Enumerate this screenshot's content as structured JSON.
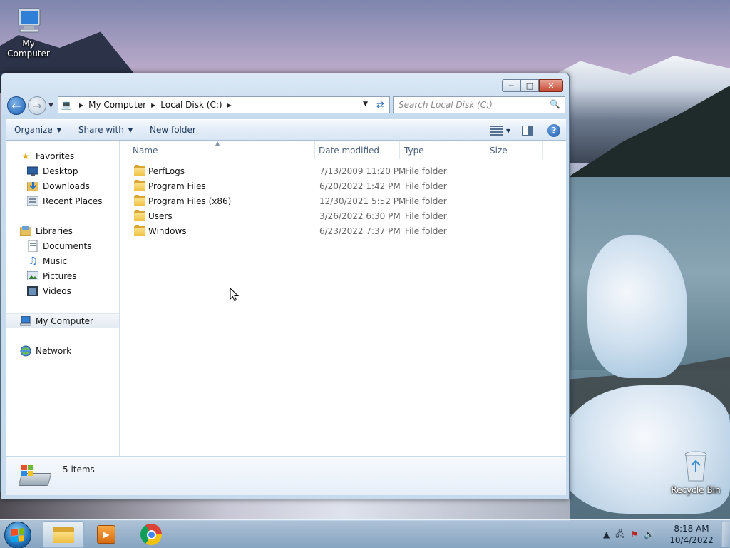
{
  "desktop": {
    "icons": [
      {
        "label": "My Computer",
        "icon": "computer-icon"
      },
      {
        "label": "Recycle Bin",
        "icon": "recycle-bin-icon"
      }
    ]
  },
  "window": {
    "caption_buttons": [
      "minimize",
      "maximize",
      "close"
    ],
    "address": {
      "crumbs": [
        "My Computer",
        "Local Disk (C:)"
      ]
    },
    "search": {
      "placeholder": "Search Local Disk (C:)"
    },
    "toolbar": {
      "organize": "Organize",
      "share_with": "Share with",
      "new_folder": "New folder"
    },
    "nav_pane": {
      "favorites": "Favorites",
      "favorites_items": [
        "Desktop",
        "Downloads",
        "Recent Places"
      ],
      "libraries": "Libraries",
      "libraries_items": [
        "Documents",
        "Music",
        "Pictures",
        "Videos"
      ],
      "my_computer": "My Computer",
      "network": "Network"
    },
    "columns": {
      "name": "Name",
      "date": "Date modified",
      "type": "Type",
      "size": "Size"
    },
    "files": [
      {
        "name": "PerfLogs",
        "date": "7/13/2009 11:20 PM",
        "type": "File folder"
      },
      {
        "name": "Program Files",
        "date": "6/20/2022 1:42 PM",
        "type": "File folder"
      },
      {
        "name": "Program Files (x86)",
        "date": "12/30/2021 5:52 PM",
        "type": "File folder"
      },
      {
        "name": "Users",
        "date": "3/26/2022 6:30 PM",
        "type": "File folder"
      },
      {
        "name": "Windows",
        "date": "6/23/2022 7:37 PM",
        "type": "File folder"
      }
    ],
    "details": {
      "count": "5 items"
    }
  },
  "taskbar": {
    "apps": [
      "windows-explorer",
      "windows-media-player",
      "google-chrome"
    ],
    "clock": {
      "time": "8:18 AM",
      "date": "10/4/2022"
    }
  }
}
